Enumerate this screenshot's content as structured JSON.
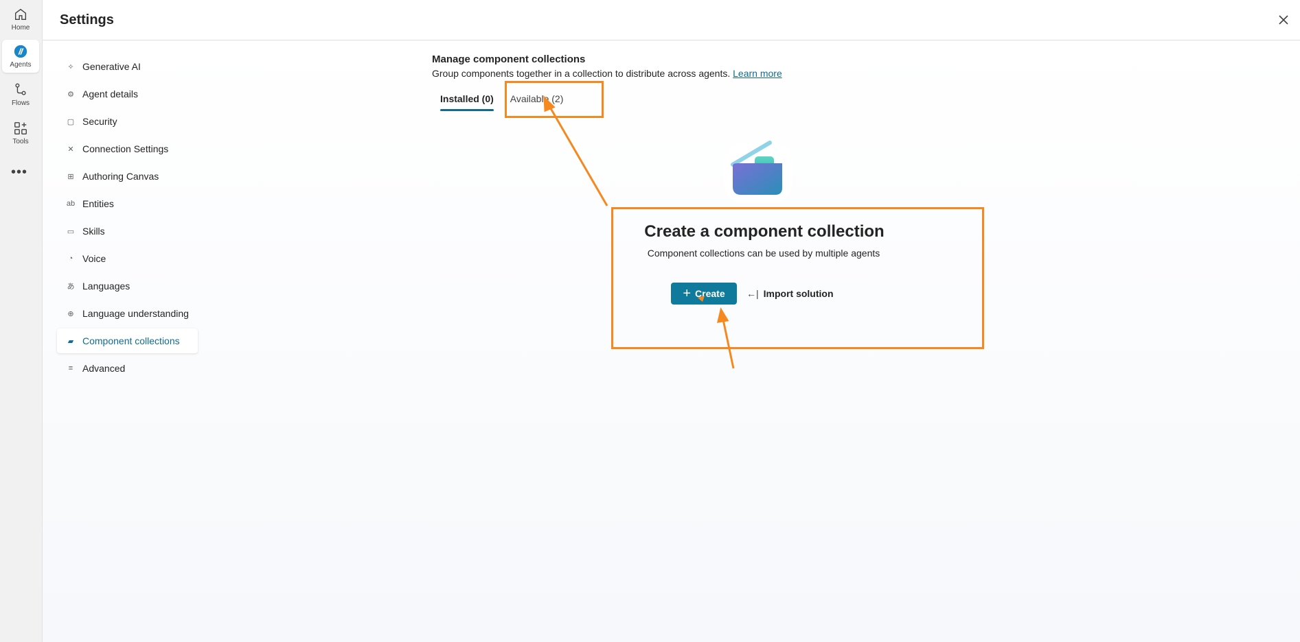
{
  "rail": {
    "items": [
      {
        "label": "Home",
        "icon": "home-icon"
      },
      {
        "label": "Agents",
        "icon": "agents-icon"
      },
      {
        "label": "Flows",
        "icon": "flows-icon"
      },
      {
        "label": "Tools",
        "icon": "tools-icon"
      }
    ],
    "more": "•••"
  },
  "header": {
    "title": "Settings"
  },
  "nav": {
    "items": [
      {
        "label": "Generative AI",
        "icon": "sparkle-icon"
      },
      {
        "label": "Agent details",
        "icon": "gear-icon"
      },
      {
        "label": "Security",
        "icon": "lock-icon"
      },
      {
        "label": "Connection Settings",
        "icon": "connection-icon"
      },
      {
        "label": "Authoring Canvas",
        "icon": "grid-icon"
      },
      {
        "label": "Entities",
        "icon": "entities-icon"
      },
      {
        "label": "Skills",
        "icon": "briefcase-icon"
      },
      {
        "label": "Voice",
        "icon": "voice-icon"
      },
      {
        "label": "Languages",
        "icon": "translate-icon"
      },
      {
        "label": "Language understanding",
        "icon": "globe-icon"
      },
      {
        "label": "Component collections",
        "icon": "folder-icon",
        "active": true
      },
      {
        "label": "Advanced",
        "icon": "sliders-icon"
      }
    ]
  },
  "content": {
    "title": "Manage component collections",
    "description": "Group components together in a collection to distribute across agents.",
    "learn_more": "Learn more",
    "tabs": [
      {
        "label": "Installed (0)",
        "selected": true
      },
      {
        "label": "Available (2)",
        "selected": false
      }
    ],
    "empty": {
      "title": "Create a component collection",
      "description": "Component collections can be used by multiple agents",
      "create_label": "Create",
      "import_label": "Import solution"
    }
  },
  "colors": {
    "accent": "#0f7a9c",
    "annotation": "#f5891f"
  }
}
